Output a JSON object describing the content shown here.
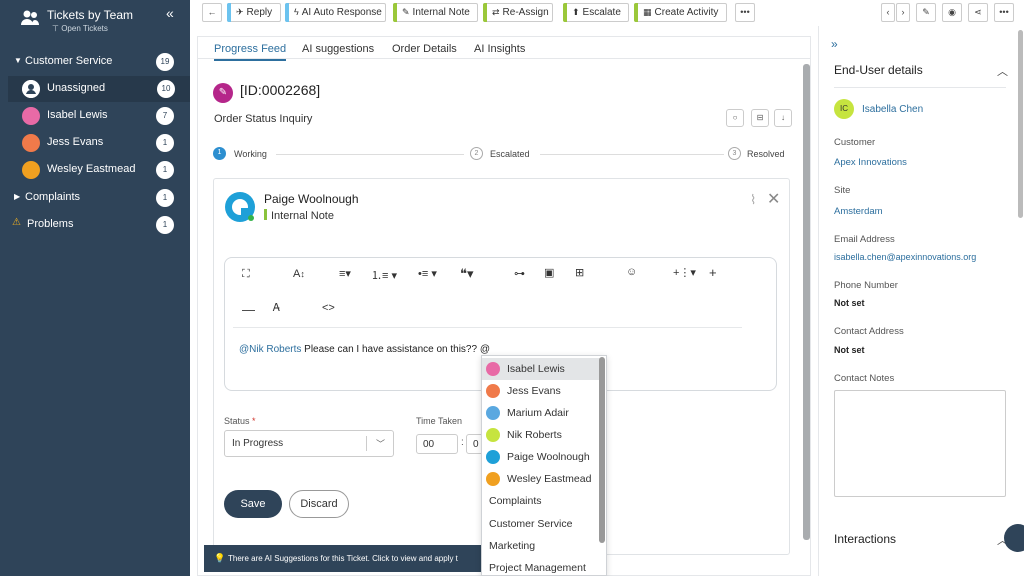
{
  "sidebar": {
    "title": "Tickets by Team",
    "subtitle": "Open Tickets",
    "collapse_icon": "«",
    "items": [
      {
        "label": "Customer Service",
        "count": "19"
      },
      {
        "label": "Unassigned",
        "count": "10"
      },
      {
        "label": "Isabel Lewis",
        "count": "7"
      },
      {
        "label": "Jess Evans",
        "count": "1"
      },
      {
        "label": "Wesley Eastmead",
        "count": "1"
      },
      {
        "label": "Complaints",
        "count": "1"
      },
      {
        "label": "Problems",
        "count": "1"
      }
    ]
  },
  "toolbar": {
    "reply": "Reply",
    "ai_auto_response": "AI Auto Response",
    "internal_note": "Internal Note",
    "reassign": "Re-Assign",
    "escalate": "Escalate",
    "create_activity": "Create Activity",
    "more": "•••",
    "colors": {
      "reply": "#6cc3ef",
      "ai": "#6cc3ef",
      "note": "#9bc83a",
      "reassign": "#9bc83a",
      "escalate": "#9bc83a",
      "activity": "#9bc83a"
    }
  },
  "tabs": [
    "Progress Feed",
    "AI suggestions",
    "Order Details",
    "AI Insights"
  ],
  "ticket": {
    "id": "[ID:0002268]",
    "title": "Order Status Inquiry",
    "steps": [
      {
        "num": "1",
        "label": "Working"
      },
      {
        "num": "2",
        "label": "Escalated"
      },
      {
        "num": "3",
        "label": "Resolved"
      }
    ]
  },
  "note": {
    "author": "Paige Woolnough",
    "type": "Internal Note",
    "mention": "@Nik Roberts",
    "body": " Please can I have assistance on this?? @"
  },
  "form": {
    "status_label": "Status",
    "status_required": "*",
    "status_value": "In Progress",
    "time_label": "Time Taken",
    "time_hours": "00",
    "time_sep": ":",
    "time_minutes": "0",
    "save": "Save",
    "discard": "Discard"
  },
  "ai_banner": "There are AI Suggestions for this Ticket. Click to view and apply t",
  "dropdown": [
    {
      "label": "Isabel Lewis",
      "avatar": true,
      "color": "#e86aa6"
    },
    {
      "label": "Jess Evans",
      "avatar": true,
      "color": "#f07a4a"
    },
    {
      "label": "Marium Adair",
      "avatar": true,
      "color": "#5aa8e0"
    },
    {
      "label": "Nik Roberts",
      "avatar": true,
      "color": "#c6e43f"
    },
    {
      "label": "Paige Woolnough",
      "avatar": true,
      "color": "#1ea0d8"
    },
    {
      "label": "Wesley Eastmead",
      "avatar": true,
      "color": "#f0a020"
    },
    {
      "label": "Complaints",
      "avatar": false
    },
    {
      "label": "Customer Service",
      "avatar": false
    },
    {
      "label": "Marketing",
      "avatar": false
    },
    {
      "label": "Project Management",
      "avatar": false
    }
  ],
  "enduser": {
    "title": "End-User details",
    "initials": "IC",
    "name": "Isabella Chen",
    "customer_label": "Customer",
    "customer": "Apex Innovations",
    "site_label": "Site",
    "site": "Amsterdam",
    "email_label": "Email Address",
    "email": "isabella.chen@apexinnovations.org",
    "phone_label": "Phone Number",
    "phone": "Not set",
    "address_label": "Contact Address",
    "address": "Not set",
    "notes_label": "Contact Notes",
    "interactions": "Interactions"
  }
}
